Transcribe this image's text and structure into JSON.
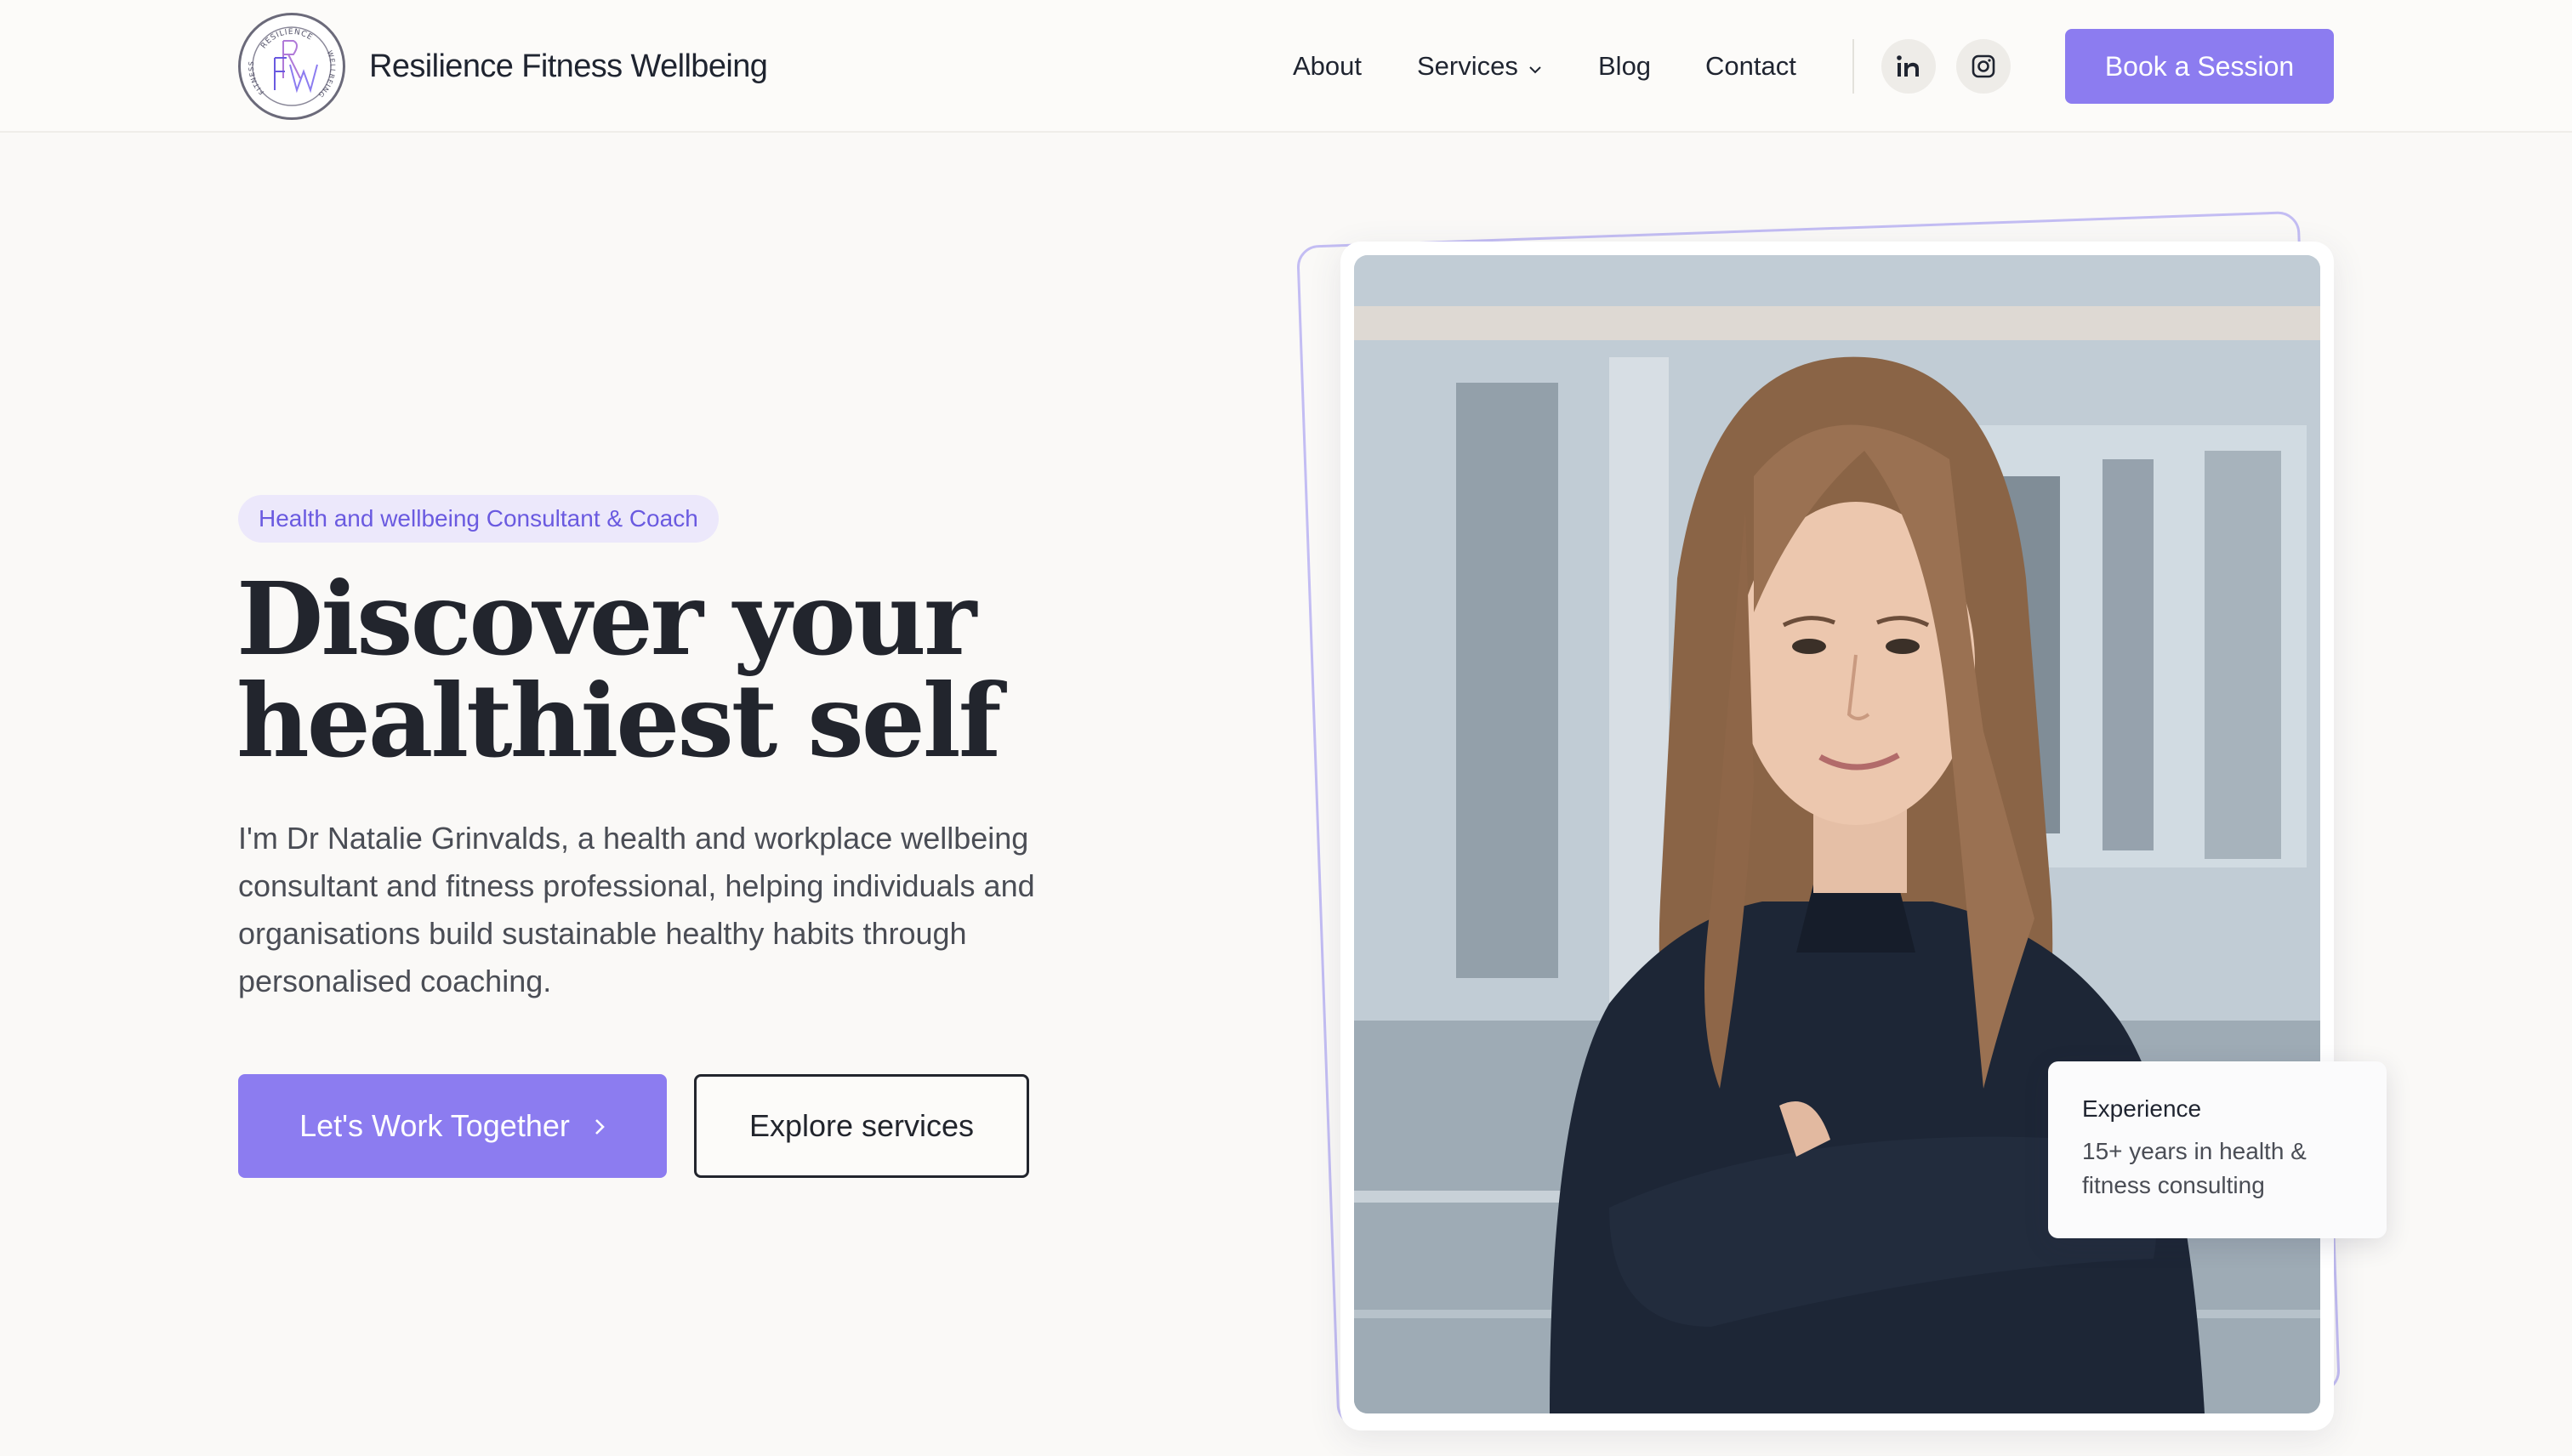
{
  "header": {
    "brand_name": "Resilience Fitness Wellbeing",
    "logo": {
      "ring_top": "RESILIENCE",
      "ring_left": "FITNESS",
      "ring_right": "WELLBEING",
      "monogram": "RFW"
    },
    "nav": [
      {
        "label": "About"
      },
      {
        "label": "Services",
        "has_dropdown": true
      },
      {
        "label": "Blog"
      },
      {
        "label": "Contact"
      }
    ],
    "social": [
      {
        "icon": "linkedin-icon"
      },
      {
        "icon": "instagram-icon"
      }
    ],
    "cta_label": "Book a Session"
  },
  "hero": {
    "badge": "Health and wellbeing Consultant & Coach",
    "title_line1": "Discover your",
    "title_line2": "healthiest self",
    "description": "I'm Dr Natalie Grinvalds, a health and workplace wellbeing consultant and fitness professional, helping individuals and organisations build sustainable healthy habits through personalised coaching.",
    "primary_cta": "Let's Work Together",
    "secondary_cta": "Explore services"
  },
  "experience_card": {
    "title": "Experience",
    "text": "15+ years in health & fitness consulting"
  },
  "colors": {
    "accent": "#8c7cf0",
    "badge_bg": "#ece8fb",
    "page_bg": "#faf9f7",
    "text_dark": "#22252d"
  }
}
